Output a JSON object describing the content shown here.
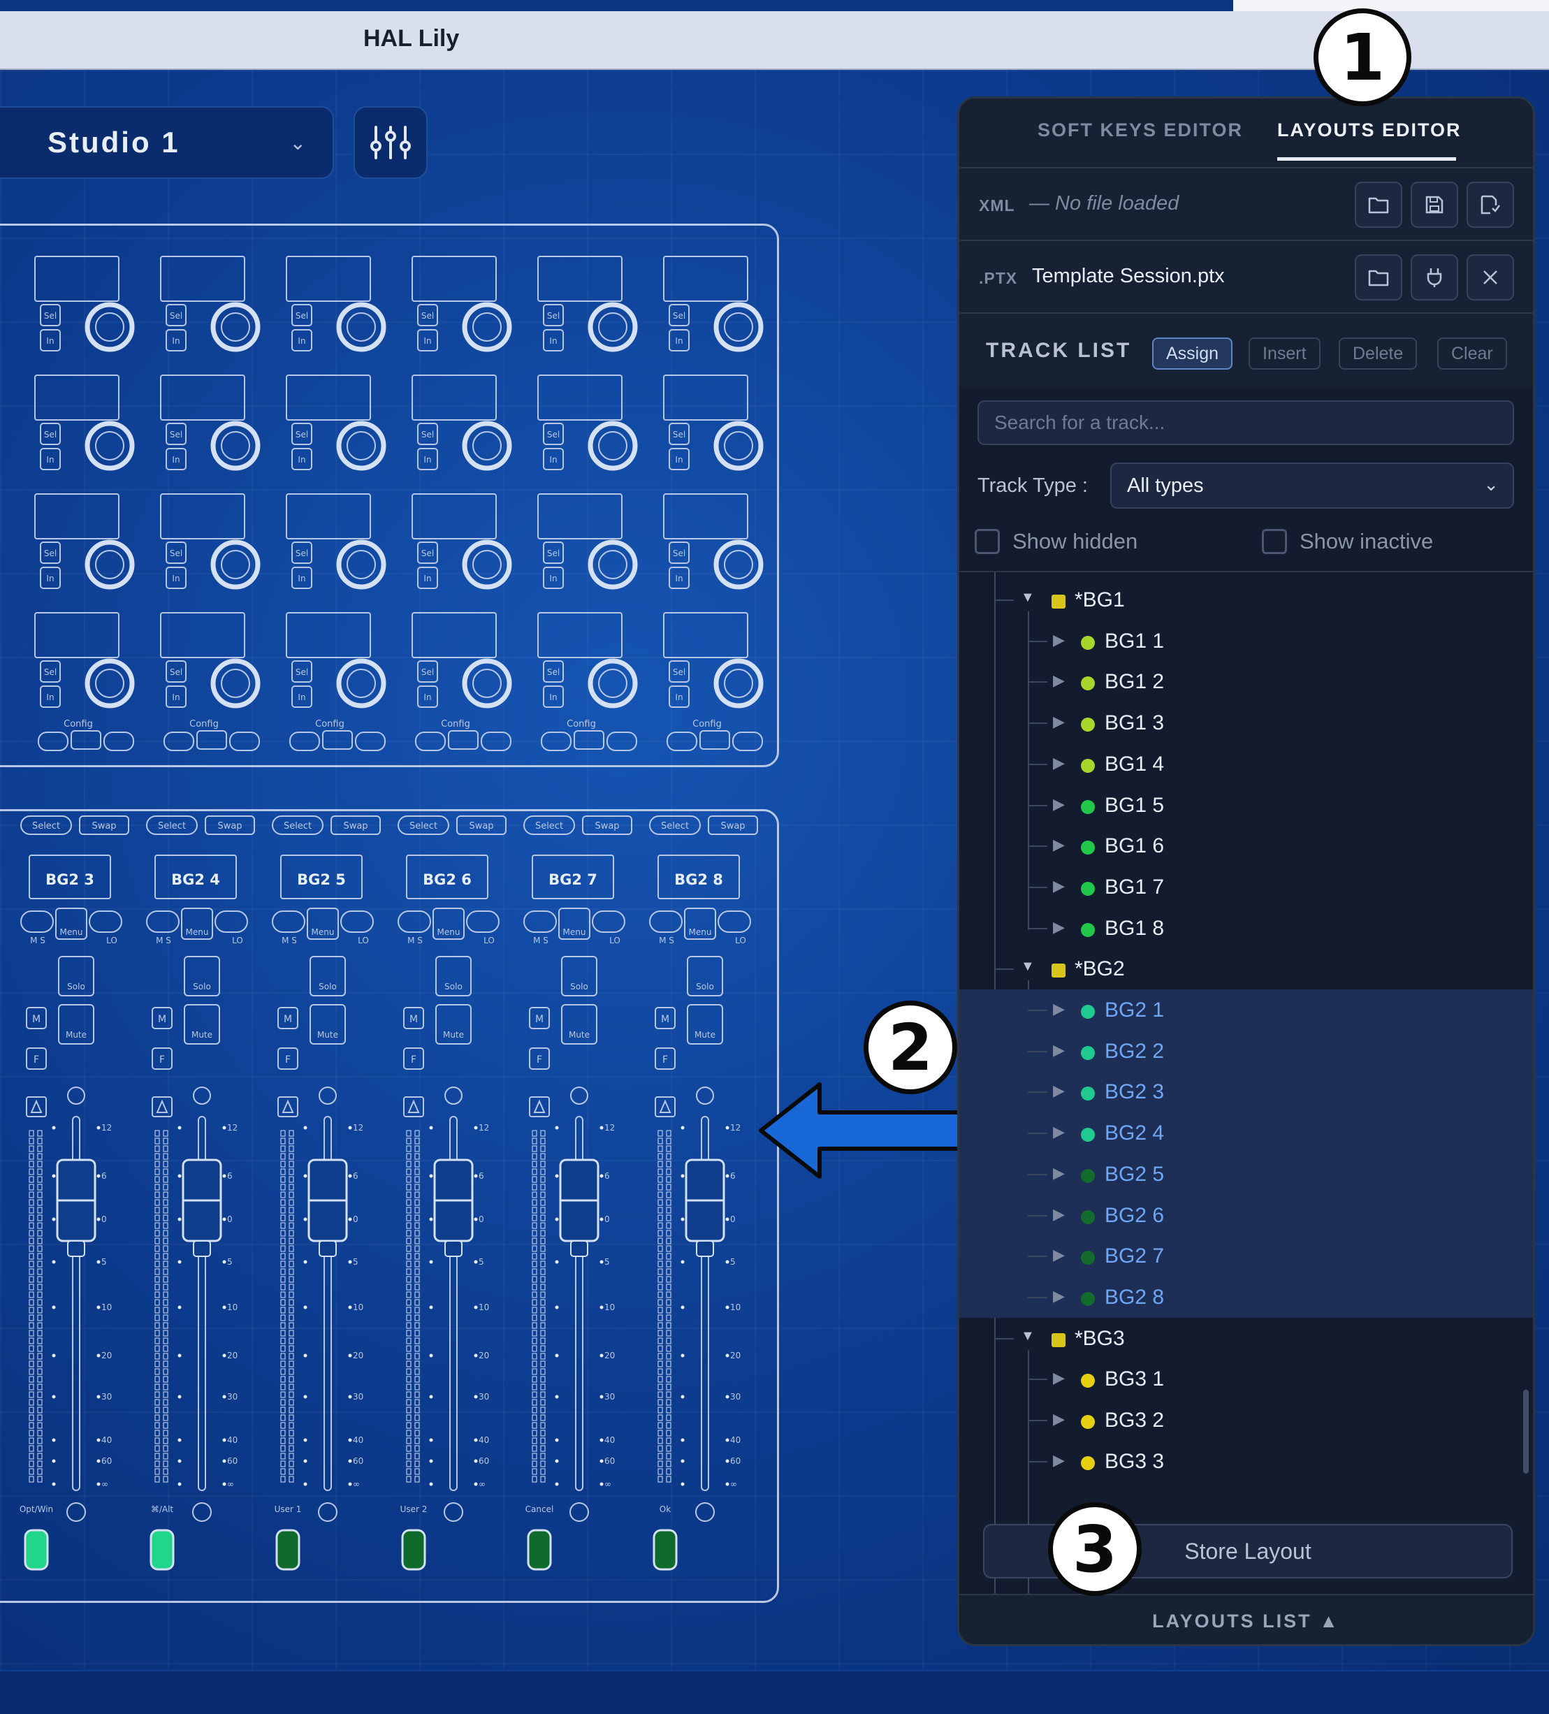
{
  "window": {
    "title": "HAL Lily"
  },
  "studio": {
    "selected": "Studio 1",
    "chevron_icon": "chevron-down-icon",
    "mixer_icon": "sliders-icon"
  },
  "editor": {
    "tabs": [
      {
        "label": "SOFT KEYS EDITOR",
        "active": false
      },
      {
        "label": "LAYOUTS EDITOR",
        "active": true
      }
    ],
    "xml": {
      "prefix": "XML",
      "value": "— No file loaded"
    },
    "ptx": {
      "prefix": ".PTX",
      "value": "Template Session.ptx"
    },
    "track_list": {
      "title": "TRACK LIST",
      "buttons": [
        "Assign",
        "Insert",
        "Delete",
        "Clear"
      ],
      "active_button": "Assign",
      "search_placeholder": "Search for a track...",
      "track_type_label": "Track Type :",
      "track_type_value": "All types",
      "show_hidden": "Show hidden",
      "show_inactive": "Show inactive"
    },
    "tree": [
      {
        "label": "*BG1",
        "level": 0,
        "color": "#d7c51c",
        "folder": true
      },
      {
        "label": "BG1 1",
        "level": 1,
        "color": "#a8d62a"
      },
      {
        "label": "BG1 2",
        "level": 1,
        "color": "#a8d62a"
      },
      {
        "label": "BG1 3",
        "level": 1,
        "color": "#a8d62a"
      },
      {
        "label": "BG1 4",
        "level": 1,
        "color": "#a8d62a"
      },
      {
        "label": "BG1 5",
        "level": 1,
        "color": "#22c84a"
      },
      {
        "label": "BG1 6",
        "level": 1,
        "color": "#22c84a"
      },
      {
        "label": "BG1 7",
        "level": 1,
        "color": "#22c84a"
      },
      {
        "label": "BG1 8",
        "level": 1,
        "color": "#22c84a"
      },
      {
        "label": "*BG2",
        "level": 0,
        "color": "#d7c51c",
        "folder": true
      },
      {
        "label": "BG2 1",
        "level": 1,
        "color": "#1fc98f",
        "selected": true
      },
      {
        "label": "BG2 2",
        "level": 1,
        "color": "#1fc98f",
        "selected": true
      },
      {
        "label": "BG2 3",
        "level": 1,
        "color": "#1fc98f",
        "selected": true
      },
      {
        "label": "BG2 4",
        "level": 1,
        "color": "#1fc98f",
        "selected": true
      },
      {
        "label": "BG2 5",
        "level": 1,
        "color": "#146b2e",
        "selected": true
      },
      {
        "label": "BG2 6",
        "level": 1,
        "color": "#146b2e",
        "selected": true
      },
      {
        "label": "BG2 7",
        "level": 1,
        "color": "#146b2e",
        "selected": true
      },
      {
        "label": "BG2 8",
        "level": 1,
        "color": "#146b2e",
        "selected": true
      },
      {
        "label": "*BG3",
        "level": 0,
        "color": "#d7c51c",
        "folder": true
      },
      {
        "label": "BG3 1",
        "level": 1,
        "color": "#e6cf10"
      },
      {
        "label": "BG3 2",
        "level": 1,
        "color": "#e6cf10"
      },
      {
        "label": "BG3 3",
        "level": 1,
        "color": "#e6cf10"
      }
    ],
    "store_layout": "Store Layout",
    "layouts_list": "LAYOUTS LIST ▲"
  },
  "surface": {
    "upper": {
      "key_sel": "Sel",
      "key_in": "In",
      "config_label": "Config"
    },
    "lower": {
      "select_label": "Select",
      "swap_label": "Swap",
      "strip_names": [
        "BG2 3",
        "BG2 4",
        "BG2 5",
        "BG2 6",
        "BG2 7",
        "BG2 8"
      ],
      "menu_label": "Menu",
      "solo_label": "Solo",
      "mute_label": "Mute",
      "m_key": "M",
      "f_key": "F",
      "ms_label": "M S",
      "lo_label": "LO",
      "scale": [
        "12",
        "6",
        "0",
        "5",
        "10",
        "20",
        "30",
        "40",
        "60",
        "∞"
      ],
      "bottom_keys": [
        "Opt/Win",
        "⌘/Alt",
        "User 1",
        "User 2",
        "Cancel",
        "Ok"
      ],
      "bottom_key_colors": [
        "#21d68a",
        "#21d68a",
        "#0f6b2c",
        "#0f6b2c",
        "#0f6b2c",
        "#0f6b2c"
      ]
    }
  },
  "callouts": [
    "1",
    "2",
    "3"
  ],
  "colors": {
    "canvas": "#0d3f93",
    "panel_bg": "#131c2e",
    "selected_row": "#1d2f56",
    "accent_blue": "#6fa7f4",
    "arrow_blue": "#1767d6"
  }
}
